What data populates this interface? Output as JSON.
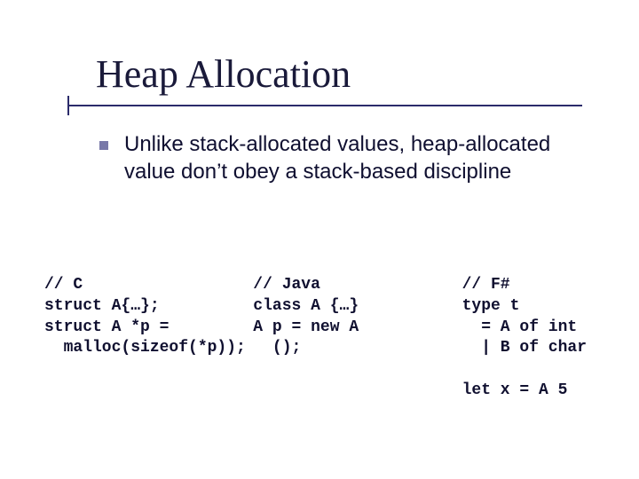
{
  "title": "Heap Allocation",
  "bullet": "Unlike stack-allocated values, heap-allocated value don’t obey a stack-based discipline",
  "code": {
    "c": "// C\nstruct A{…};\nstruct A *p = \n  malloc(sizeof(*p));",
    "java": "// Java\nclass A {…}\nA p = new A\n  ();",
    "fsharp": "// F#\ntype t\n  = A of int\n  | B of char\n\nlet x = A 5"
  }
}
